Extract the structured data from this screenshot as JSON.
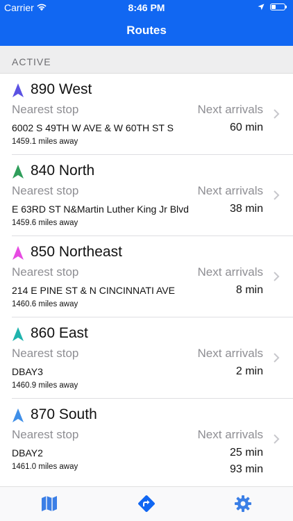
{
  "status_bar": {
    "carrier": "Carrier",
    "time": "8:46 PM"
  },
  "nav": {
    "title": "Routes"
  },
  "section": {
    "header": "ACTIVE"
  },
  "labels": {
    "nearest_stop": "Nearest stop",
    "next_arrivals": "Next arrivals"
  },
  "routes": [
    {
      "name": "890 West",
      "color": "#5b52e3",
      "stop": "6002 S 49TH W AVE & W 60TH ST S",
      "distance": "1459.1 miles away",
      "arrivals": [
        "60 min"
      ]
    },
    {
      "name": "840 North",
      "color": "#2f9e5b",
      "stop": "E 63RD ST N&Martin Luther King Jr Blvd",
      "distance": "1459.6 miles away",
      "arrivals": [
        "38 min"
      ]
    },
    {
      "name": "850 Northeast",
      "color": "#e74be2",
      "stop": "214 E PINE ST & N CINCINNATI AVE",
      "distance": "1460.6 miles away",
      "arrivals": [
        "8 min"
      ]
    },
    {
      "name": "860 East",
      "color": "#1fb3ad",
      "stop": "DBAY3",
      "distance": "1460.9 miles away",
      "arrivals": [
        "2 min"
      ]
    },
    {
      "name": "870 South",
      "color": "#3f8fe8",
      "stop": "DBAY2",
      "distance": "1461.0 miles away",
      "arrivals": [
        "25 min",
        "93 min"
      ]
    }
  ],
  "tabbar": {
    "items": [
      {
        "icon": "map-icon",
        "active": false
      },
      {
        "icon": "routes-icon",
        "active": true
      },
      {
        "icon": "gear-icon",
        "active": false
      }
    ],
    "active_color": "#1167f2",
    "inactive_color": "#3b7fe6"
  }
}
